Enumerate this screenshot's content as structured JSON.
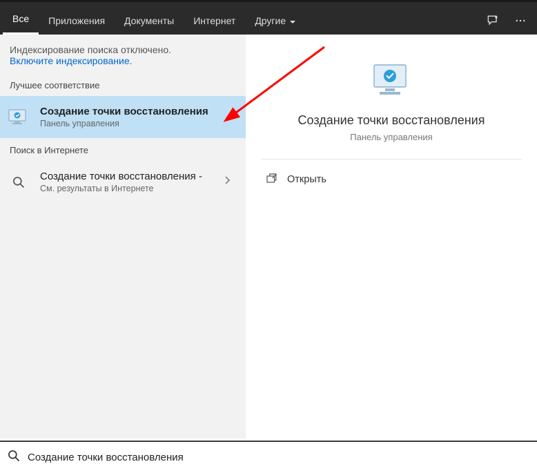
{
  "tabs": {
    "all": "Все",
    "apps": "Приложения",
    "docs": "Документы",
    "web": "Интернет",
    "more": "Другие"
  },
  "notice": {
    "line": "Индексирование поиска отключено.",
    "link": "Включите индексирование."
  },
  "sections": {
    "best": "Лучшее соответствие",
    "web": "Поиск в Интернете"
  },
  "result_best": {
    "title": "Создание точки восстановления",
    "sub": "Панель управления"
  },
  "result_web": {
    "title": "Создание точки восстановления",
    "dash": " - ",
    "sub": "См. результаты в Интернете"
  },
  "preview": {
    "title": "Создание точки восстановления",
    "sub": "Панель управления"
  },
  "actions": {
    "open": "Открыть"
  },
  "search": {
    "value": "Создание точки восстановления"
  }
}
